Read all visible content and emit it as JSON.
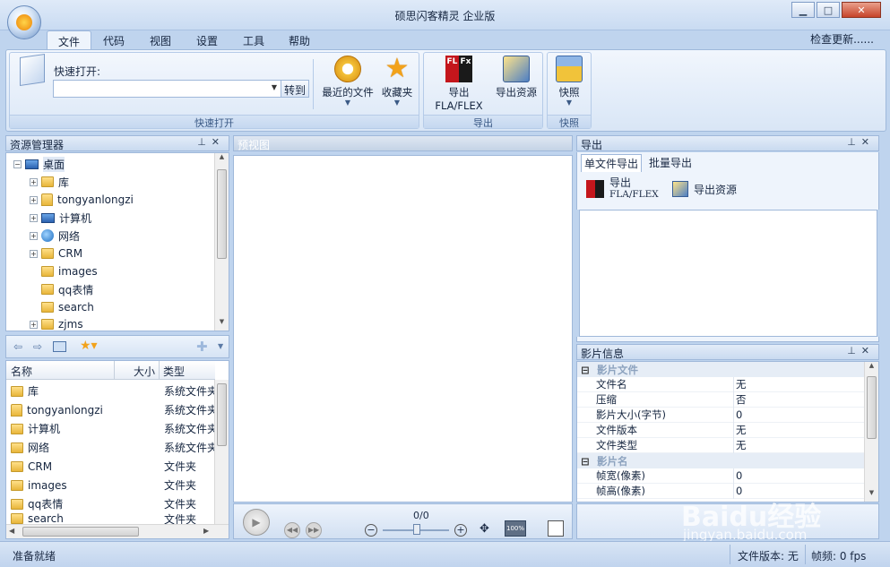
{
  "window": {
    "title": "硕思闪客精灵 企业版",
    "min": "▁",
    "max": "□",
    "close": "✕"
  },
  "menu": {
    "tabs": [
      "文件",
      "代码",
      "视图",
      "设置",
      "工具",
      "帮助"
    ],
    "active": 0,
    "check_update": "检查更新......"
  },
  "ribbon": {
    "quick_open": {
      "label": "快速打开:",
      "goto": "转到",
      "recent": "最近的文件",
      "favorites": "收藏夹",
      "caption": "快速打开"
    },
    "export": {
      "fla": "导出FLA/FLEX",
      "res": "导出资源",
      "caption": "导出",
      "flfx_icon_text": "FL Fx"
    },
    "snapshot": {
      "btn": "快照",
      "caption": "快照"
    }
  },
  "explorer": {
    "title": "资源管理器",
    "tree": [
      "桌面",
      "库",
      "tongyanlongzi",
      "计算机",
      "网络",
      "CRM",
      "images",
      "qq表情",
      "search",
      "zjms"
    ],
    "columns": {
      "name": "名称",
      "size": "大小",
      "type": "类型"
    },
    "rows": [
      {
        "name": "库",
        "type": "系统文件夹"
      },
      {
        "name": "tongyanlongzi",
        "type": "系统文件夹"
      },
      {
        "name": "计算机",
        "type": "系统文件夹"
      },
      {
        "name": "网络",
        "type": "系统文件夹"
      },
      {
        "name": "CRM",
        "type": "文件夹"
      },
      {
        "name": "images",
        "type": "文件夹"
      },
      {
        "name": "qq表情",
        "type": "文件夹"
      },
      {
        "name": "search",
        "type": "文件夹"
      }
    ]
  },
  "preview": {
    "title": "预视图",
    "frame": "0/0",
    "zoom_icon_text": "100%"
  },
  "export_panel": {
    "title": "导出",
    "tabs": [
      "单文件导出",
      "批量导出"
    ],
    "fla_line1": "导出",
    "fla_line2": "FLA/FLEX",
    "res": "导出资源"
  },
  "movie_info": {
    "title": "影片信息",
    "cat1": "影片文件",
    "cat2": "影片名",
    "props1": [
      {
        "k": "文件名",
        "v": "无"
      },
      {
        "k": "压缩",
        "v": "否"
      },
      {
        "k": "影片大小(字节)",
        "v": "0"
      },
      {
        "k": "文件版本",
        "v": "无"
      },
      {
        "k": "文件类型",
        "v": "无"
      }
    ],
    "props2": [
      {
        "k": "帧宽(像素)",
        "v": "0"
      },
      {
        "k": "帧高(像素)",
        "v": "0"
      }
    ]
  },
  "status": {
    "ready": "准备就绪",
    "file_version": "文件版本: 无",
    "fps": "帧频: 0 fps"
  },
  "watermark": {
    "brand": "Baidu经验",
    "url": "jingyan.baidu.com"
  }
}
